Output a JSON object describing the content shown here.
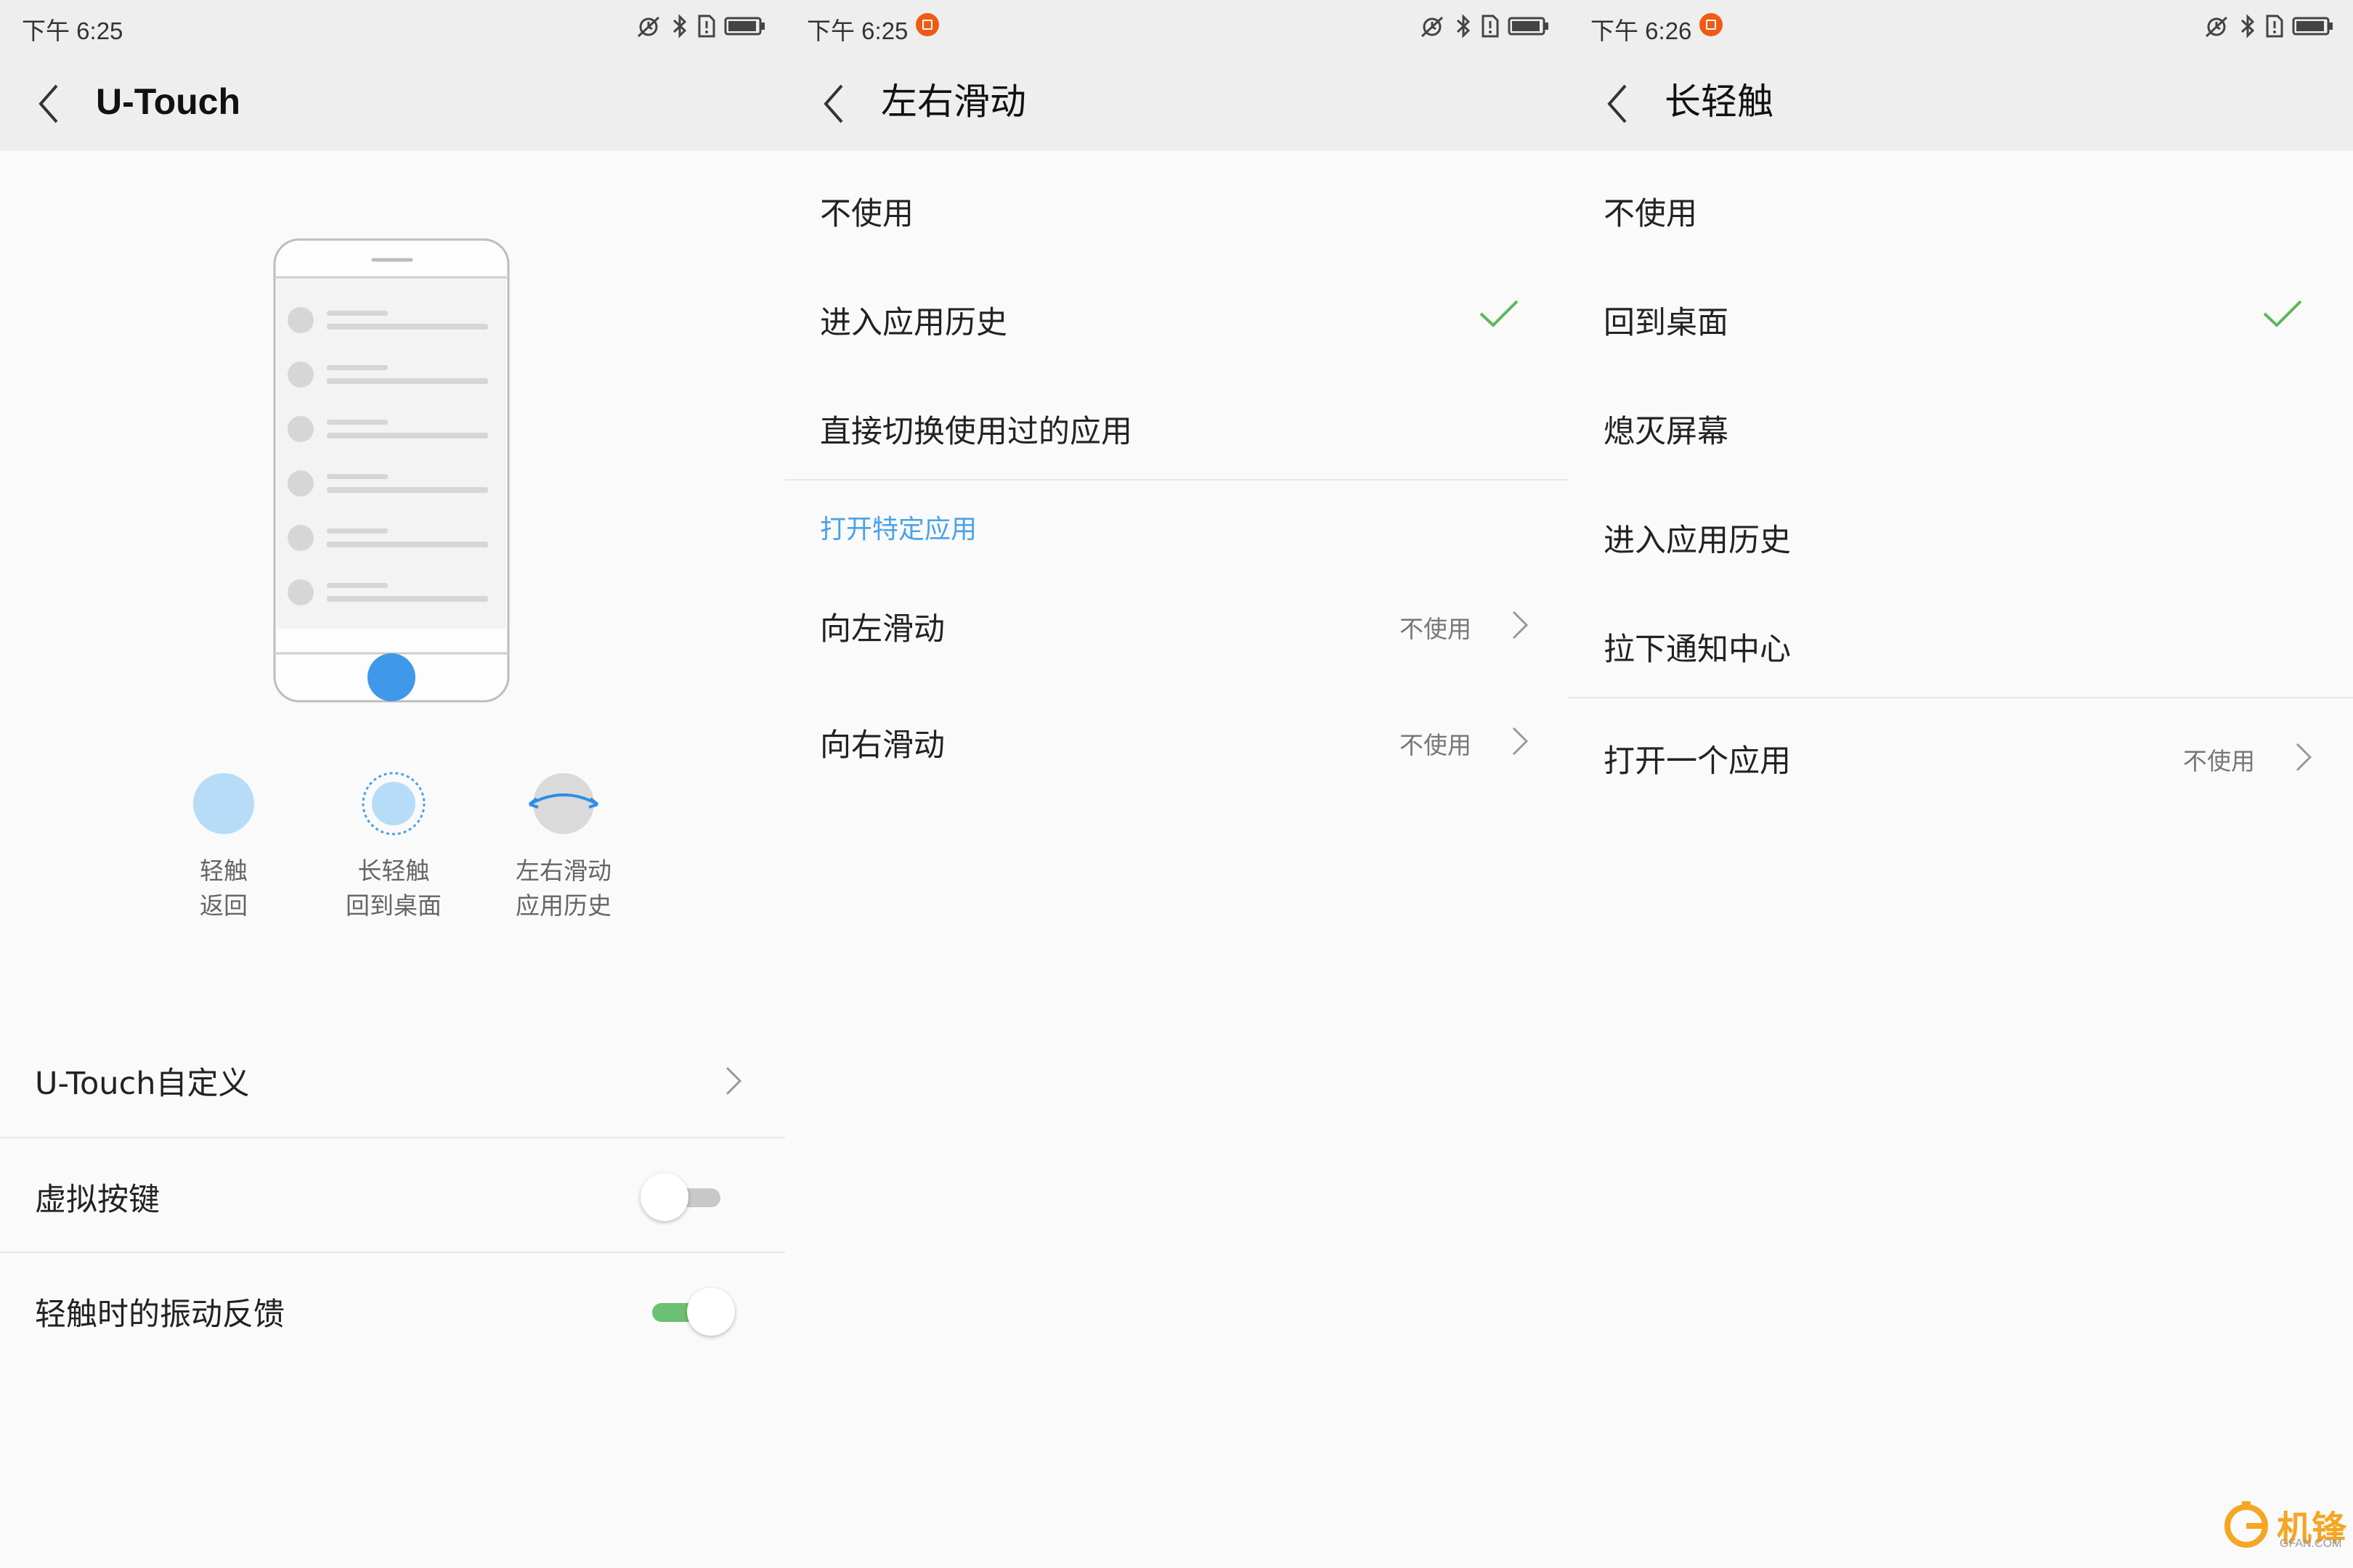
{
  "colors": {
    "accent_blue": "#4aa3e8",
    "check_green": "#5cb85c",
    "toggle_on": "#6cc073",
    "bg": "#fafafa",
    "bar": "#eeeeee"
  },
  "panel1": {
    "status_time": "下午 6:25",
    "title": "U-Touch",
    "gestures": [
      {
        "line1": "轻触",
        "line2": "返回"
      },
      {
        "line1": "长轻触",
        "line2": "回到桌面"
      },
      {
        "line1": "左右滑动",
        "line2": "应用历史"
      }
    ],
    "rows": {
      "customize": "U-Touch自定义",
      "virtual_keys": "虚拟按键",
      "vibration": "轻触时的振动反馈"
    },
    "virtual_keys_on": false,
    "vibration_on": true
  },
  "panel2": {
    "status_time": "下午 6:25",
    "title": "左右滑动",
    "options": [
      "不使用",
      "进入应用历史",
      "直接切换使用过的应用"
    ],
    "selected_index": 1,
    "section_title": "打开特定应用",
    "sub_rows": [
      {
        "label": "向左滑动",
        "value": "不使用"
      },
      {
        "label": "向右滑动",
        "value": "不使用"
      }
    ]
  },
  "panel3": {
    "status_time": "下午 6:26",
    "title": "长轻触",
    "options": [
      "不使用",
      "回到桌面",
      "熄灭屏幕",
      "进入应用历史",
      "拉下通知中心"
    ],
    "selected_index": 1,
    "app_row": {
      "label": "打开一个应用",
      "value": "不使用"
    }
  },
  "watermark": {
    "name": "机锋",
    "domain": "GFAN.COM"
  }
}
